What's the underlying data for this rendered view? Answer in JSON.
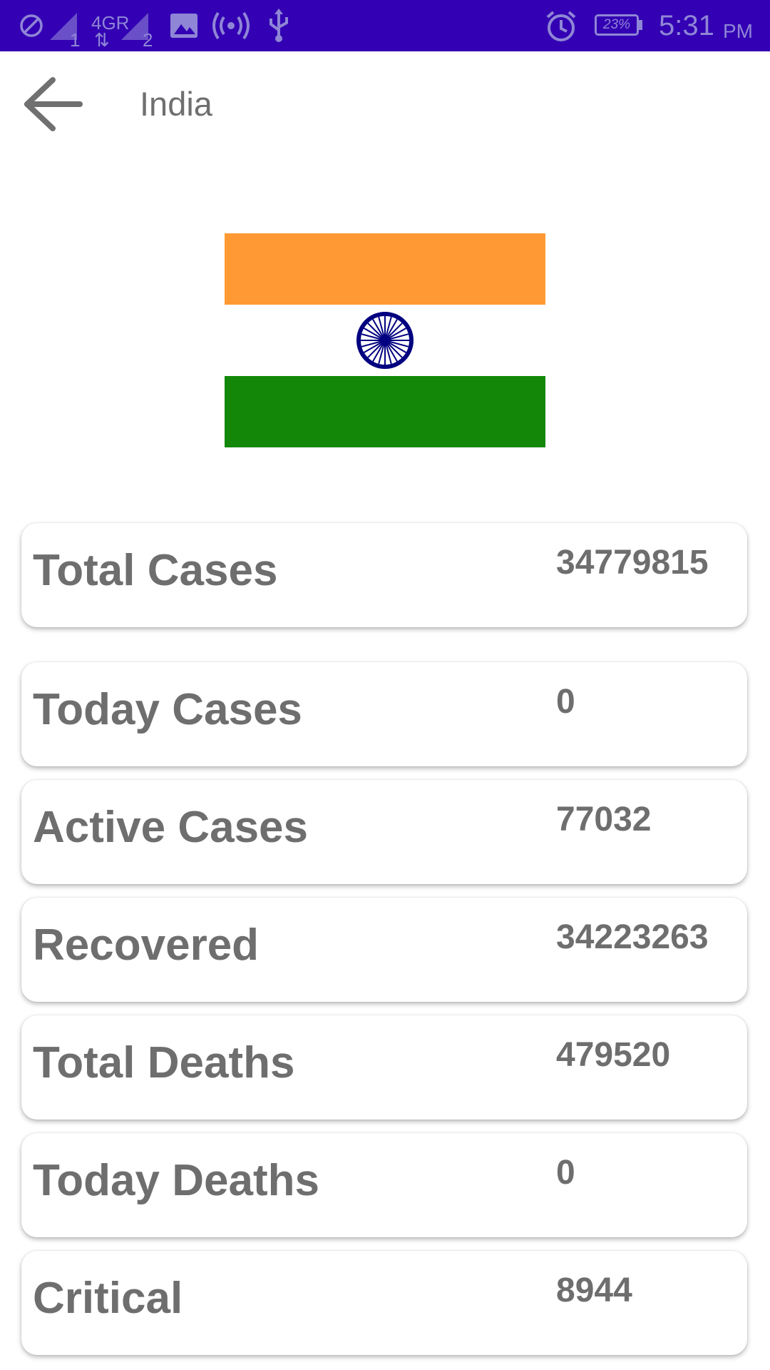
{
  "status_bar": {
    "network_label": "4GR",
    "sim1_index": "1",
    "sim2_index": "2",
    "battery": "23%",
    "time": "5:31",
    "ampm": "PM",
    "icons": [
      "do-not-disturb-icon",
      "signal-icon",
      "signal-icon",
      "image-icon",
      "hotspot-icon",
      "usb-icon",
      "alarm-icon",
      "battery-icon"
    ]
  },
  "toolbar": {
    "title": "India",
    "back_icon": "arrow-left-icon"
  },
  "flag": {
    "country": "India",
    "colors": {
      "saffron": "#ff9933",
      "white": "#ffffff",
      "green": "#138808",
      "chakra": "#000080"
    }
  },
  "stats": [
    {
      "label": "Total Cases",
      "value": "34779815"
    },
    {
      "label": "Today Cases",
      "value": "0"
    },
    {
      "label": "Active Cases",
      "value": "77032"
    },
    {
      "label": "Recovered",
      "value": "34223263"
    },
    {
      "label": "Total Deaths",
      "value": "479520"
    },
    {
      "label": "Today Deaths",
      "value": "0"
    },
    {
      "label": "Critical",
      "value": "8944"
    }
  ],
  "theme": {
    "status_bar_color": "#3300b3",
    "text_color": "#6e6e6e"
  }
}
